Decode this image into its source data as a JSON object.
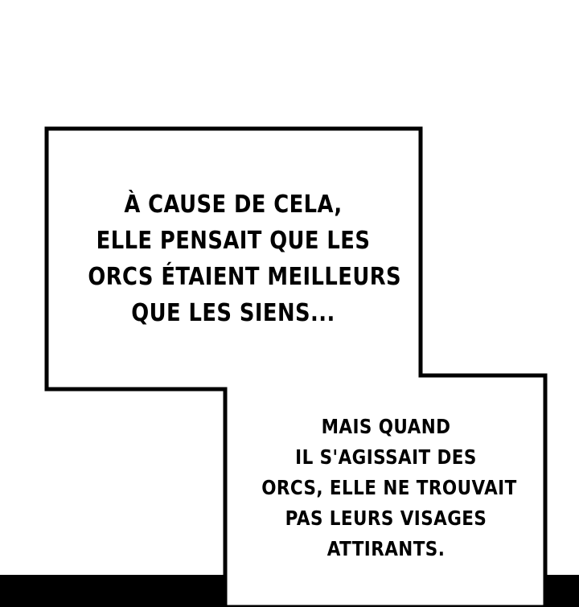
{
  "panel": {
    "caption_top": {
      "lines": [
        "À CAUSE DE CELA,",
        "ELLE PENSAIT QUE LES",
        "ORCS ÉTAIENT MEILLEURS",
        "QUE LES SIENS..."
      ]
    },
    "caption_bottom": {
      "lines": [
        "MAIS QUAND",
        "IL S'AGISSAIT DES",
        "ORCS, ELLE NE TROUVAIT",
        "PAS LEURS VISAGES",
        "ATTIRANTS."
      ]
    }
  },
  "colors": {
    "background": "#ffffff",
    "border": "#000000",
    "text": "#000000"
  }
}
